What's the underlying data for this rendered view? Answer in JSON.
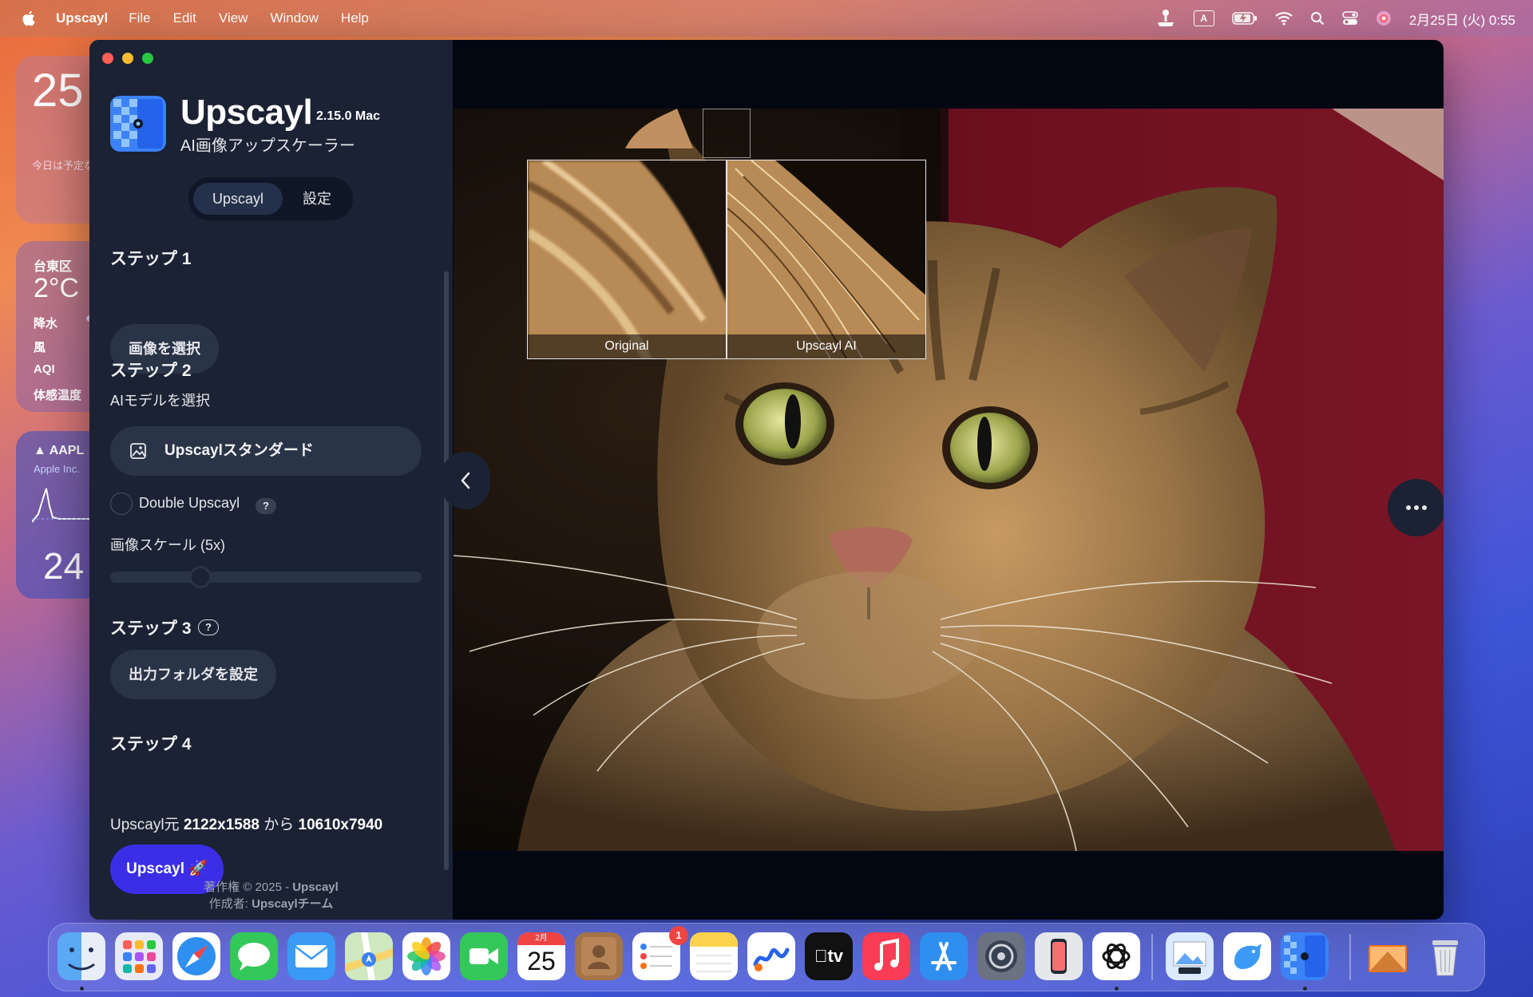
{
  "menubar": {
    "app_name": "Upscayl",
    "menus": [
      "File",
      "Edit",
      "View",
      "Window",
      "Help"
    ],
    "clock": "2月25日 (火) 0:55",
    "input_indicator": "A"
  },
  "widgets": {
    "calendar": {
      "day": "25",
      "note": "今日は予定なし"
    },
    "weather": {
      "location": "台東区",
      "temp": "2°C",
      "rows": [
        "降水",
        "風",
        "AQI",
        "体感温度"
      ]
    },
    "stock": {
      "symbol": "▲ AAPL",
      "name": "Apple Inc.",
      "price": "24"
    }
  },
  "sidebar": {
    "title": "Upscayl",
    "version": "2.15.0 Mac",
    "subtitle": "AI画像アップスケーラー",
    "tabs": {
      "active": "Upscayl",
      "other": "設定"
    },
    "step1": {
      "title": "ステップ 1",
      "button": "画像を選択"
    },
    "step2": {
      "title": "ステップ 2",
      "model_label": "AIモデルを選択",
      "model_value": "Upscaylスタンダード",
      "double_upscayl": "Double Upscayl",
      "help": "?",
      "scale_label": "画像スケール (5x)",
      "scale_fraction": 0.29
    },
    "step3": {
      "title": "ステップ 3",
      "help": "?",
      "button": "出力フォルダを設定"
    },
    "step4": {
      "title": "ステップ 4",
      "info_prefix": "Upscayl元",
      "from_size": "2122x1588",
      "middle": "から",
      "to_size": "10610x7940",
      "button": "Upscayl 🚀"
    },
    "footer": {
      "copyright_prefix": "著作権 © 2025 -",
      "copyright_name": "Upscayl",
      "author_prefix": "作成者:",
      "author_name": "Upscaylチーム"
    }
  },
  "main": {
    "zoom_original": "Original",
    "zoom_ai": "Upscayl AI"
  },
  "dock": {
    "apps": [
      "finder-icon",
      "launchpad-icon",
      "safari-icon",
      "messages-icon",
      "mail-icon",
      "maps-icon",
      "photos-icon",
      "facetime-icon",
      "calendar-icon",
      "contacts-icon",
      "reminders-icon",
      "notes-icon",
      "freeform-icon",
      "tv-icon",
      "music-icon",
      "app-store-icon",
      "system-settings-icon",
      "iphone-mirroring-icon",
      "chatgpt-icon",
      "preview-icon",
      "bird-app-icon",
      "upscayl-icon",
      "downloads-icon",
      "trash-icon"
    ],
    "calendar_month": "2月",
    "calendar_day": "25",
    "reminders_badge": "1",
    "tv_label": "tv"
  }
}
